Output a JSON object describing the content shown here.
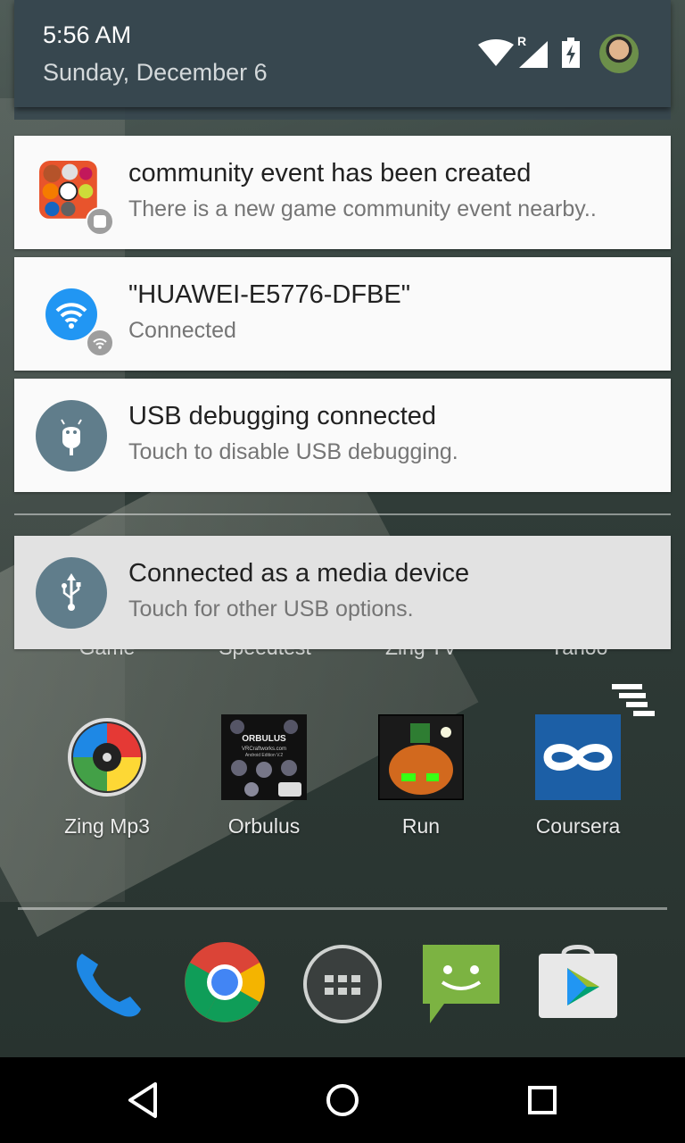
{
  "status_bar": {
    "time": "5:56 AM",
    "date": "Sunday, December 6",
    "roaming_indicator": "R",
    "icons": [
      "wifi-icon",
      "cell-signal-icon",
      "battery-charging-icon",
      "avatar"
    ]
  },
  "notifications": [
    {
      "title": "community event has been created",
      "text": "There is a new game community event nearby..",
      "icon": "game-balls-icon",
      "badge_icon": "small-app-icon"
    },
    {
      "title": "\"HUAWEI-E5776-DFBE\"",
      "text": "Connected",
      "icon": "wifi-icon",
      "badge_icon": "wifi-small-icon",
      "accent": "#2196f3"
    },
    {
      "title": "USB debugging connected",
      "text": "Touch to disable USB debugging.",
      "icon": "android-debug-icon",
      "accent": "#607d8b"
    }
  ],
  "ongoing_notifications": [
    {
      "title": "Connected as a media device",
      "text": "Touch for other USB options.",
      "icon": "usb-icon",
      "accent": "#607d8b"
    }
  ],
  "home": {
    "partially_hidden_labels": [
      "Game",
      "Speedtest",
      "Zing TV",
      "Yahoo"
    ],
    "apps": [
      {
        "label": "Zing Mp3",
        "icon": "zing-mp3-icon"
      },
      {
        "label": "Orbulus",
        "icon": "orbulus-icon",
        "icon_text": "ORBULUS",
        "icon_subtext": "VRCraftworks.com",
        "icon_subtext2": "Android Edition V.2"
      },
      {
        "label": "Run",
        "icon": "run-game-icon"
      },
      {
        "label": "Coursera",
        "icon": "coursera-icon"
      }
    ],
    "dock": [
      "phone-icon",
      "chrome-icon",
      "app-drawer-icon",
      "messaging-icon",
      "play-store-icon"
    ]
  },
  "nav": [
    "back-button",
    "home-button",
    "recents-button"
  ],
  "colors": {
    "shade_header": "#37474f",
    "card": "#fafafa",
    "ongoing_card": "#e2e2e2",
    "accent_blue": "#2196f3",
    "accent_slate": "#607d8b"
  }
}
